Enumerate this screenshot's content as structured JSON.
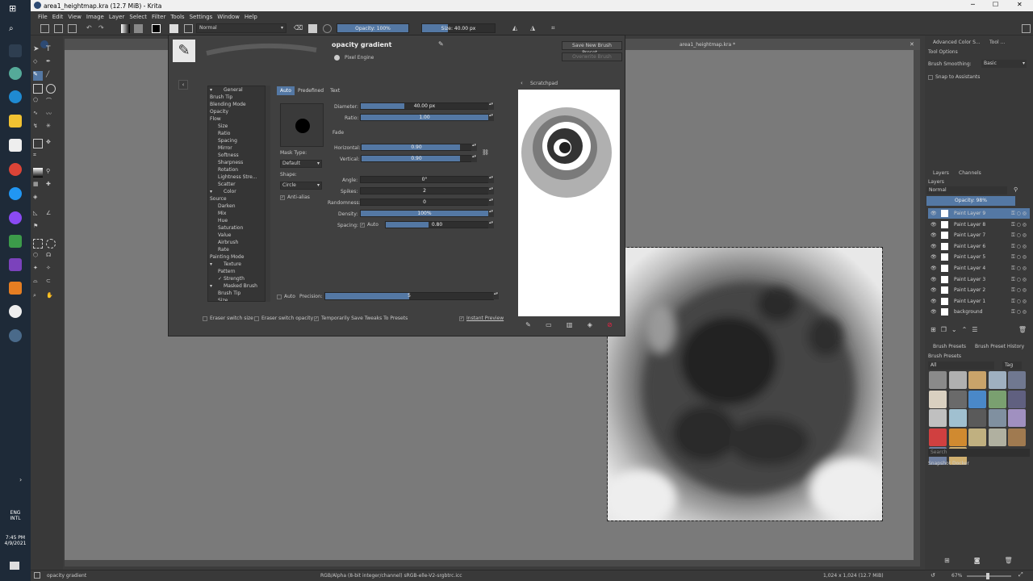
{
  "window": {
    "title": "area1_heightmap.kra (12.7 MiB) - Krita",
    "min_icon": "minimize-icon",
    "max_icon": "maximize-icon",
    "close_icon": "close-icon"
  },
  "menu": [
    "File",
    "Edit",
    "View",
    "Image",
    "Layer",
    "Select",
    "Filter",
    "Tools",
    "Settings",
    "Window",
    "Help"
  ],
  "toolbar": {
    "blend_mode": "Normal",
    "opacity": "Opacity: 100%",
    "size": "Size: 40.00 px"
  },
  "document_tab": "area1_heightmap.kra *",
  "editor": {
    "preset_name": "opacity gradient",
    "engine": "Pixel Engine",
    "save_new": "Save New Brush Preset...",
    "overwrite": "Overwrite Brush",
    "scratchpad": "Scratchpad",
    "tabs": [
      "Auto",
      "Predefined",
      "Text"
    ],
    "options": [
      "General",
      "Brush Tip",
      "Blending Mode",
      "Opacity",
      "Flow",
      "Size",
      "Ratio",
      "Spacing",
      "Mirror",
      "Softness",
      "Sharpness",
      "Rotation",
      "Lightness Stre...",
      "Scatter",
      "Color",
      "Source",
      "Darken",
      "Mix",
      "Hue",
      "Saturation",
      "Value",
      "Airbrush",
      "Rate",
      "Painting Mode",
      "Texture",
      "Pattern",
      "Strength",
      "Masked Brush",
      "Brush Tip",
      "Size"
    ],
    "mask_type_label": "Mask Type:",
    "mask_type": "Default",
    "shape_label": "Shape:",
    "shape": "Circle",
    "antialias": "Anti-alias",
    "diameter_label": "Diameter:",
    "diameter": "40.00 px",
    "diameter_frac": 0.34,
    "ratio_label": "Ratio:",
    "ratio": "1.00",
    "ratio_frac": 1.0,
    "fade_label": "Fade",
    "horizontal_label": "Horizontal:",
    "horizontal": "0.90",
    "horizontal_frac": 0.9,
    "vertical_label": "Vertical:",
    "vertical": "0.90",
    "vertical_frac": 0.9,
    "angle_label": "Angle:",
    "angle": "0°",
    "spikes_label": "Spikes:",
    "spikes": "2",
    "randomness_label": "Randomness:",
    "randomness": "0",
    "density_label": "Density:",
    "density": "100%",
    "density_frac": 1.0,
    "spacing_label": "Spacing:",
    "spacing_auto": "Auto",
    "spacing": "0.80",
    "spacing_frac": 0.42,
    "precision_auto": "Auto",
    "precision_label": "Precision:",
    "precision": "5",
    "precision_frac": 0.5,
    "eraser_size": "Eraser switch size",
    "eraser_opacity": "Eraser switch opacity",
    "temp_save": "Temporarily Save Tweaks To Presets",
    "instant_preview": "Instant Preview"
  },
  "right": {
    "tab1": "Advanced Color S...",
    "tab2": "Tool ...",
    "tool_options": "Tool Options",
    "brush_smoothing_label": "Brush Smoothing:",
    "brush_smoothing": "Basic",
    "snap": "Snap to Assistants",
    "layers_tab": "Layers",
    "channels_tab": "Channels",
    "layers_label": "Layers",
    "blend": "Normal",
    "opacity": "Opacity: 98%",
    "layers": [
      "Paint Layer 9",
      "Paint Layer 8",
      "Paint Layer 7",
      "Paint Layer 6",
      "Paint Layer 5",
      "Paint Layer 4",
      "Paint Layer 3",
      "Paint Layer 2",
      "Paint Layer 1",
      "background"
    ],
    "brush_presets_tab": "Brush Presets",
    "history_tab": "Brush Preset History",
    "brush_presets_label": "Brush Presets",
    "filter": "All",
    "tag": "Tag",
    "search": "Search",
    "snapshot": "Snapshot Docker"
  },
  "status": {
    "preset": "opacity gradient",
    "color": "RGB/Alpha (8-bit integer/channel)  sRGB-elle-V2-srgbtrc.icc",
    "size": "1,024 x 1,024 (12.7 MiB)",
    "zoom": "67%"
  },
  "clock": {
    "lang1": "ENG",
    "lang2": "INTL",
    "time": "7:45 PM",
    "date": "4/9/2021"
  }
}
